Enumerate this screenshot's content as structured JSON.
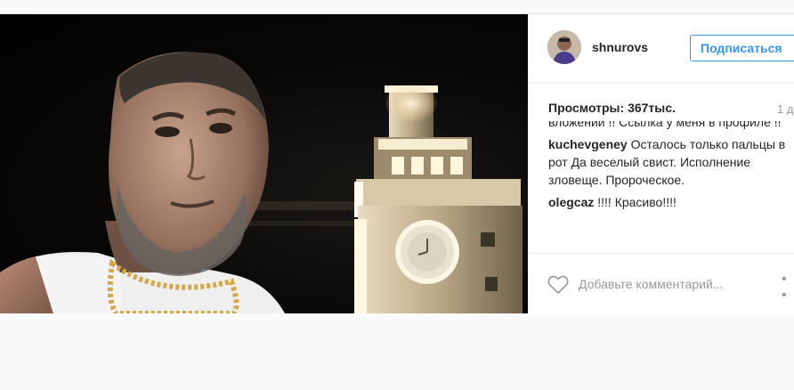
{
  "post": {
    "username": "shnurovs",
    "follow_label": "Подписаться",
    "views_label": "Просмотры:",
    "views_count": "367тыс.",
    "time": "1 д",
    "comments": [
      {
        "author": "",
        "text": "вложении !! Ссылка у меня в профиле !!"
      },
      {
        "author": "kuchevgeney",
        "text": "Осталось только пальцы в рот Да веселый свист. Исполнение зловеще. Пророческое."
      },
      {
        "author": "olegcaz",
        "text": "!!!! Красиво!!!!"
      }
    ],
    "comment_placeholder": "Добавьте комментарий...",
    "more_label": "• •",
    "icons": {
      "like": "heart-icon",
      "more": "more-options-icon"
    },
    "colors": {
      "accent": "#3897f0",
      "text": "#262626",
      "muted": "#999999"
    }
  }
}
